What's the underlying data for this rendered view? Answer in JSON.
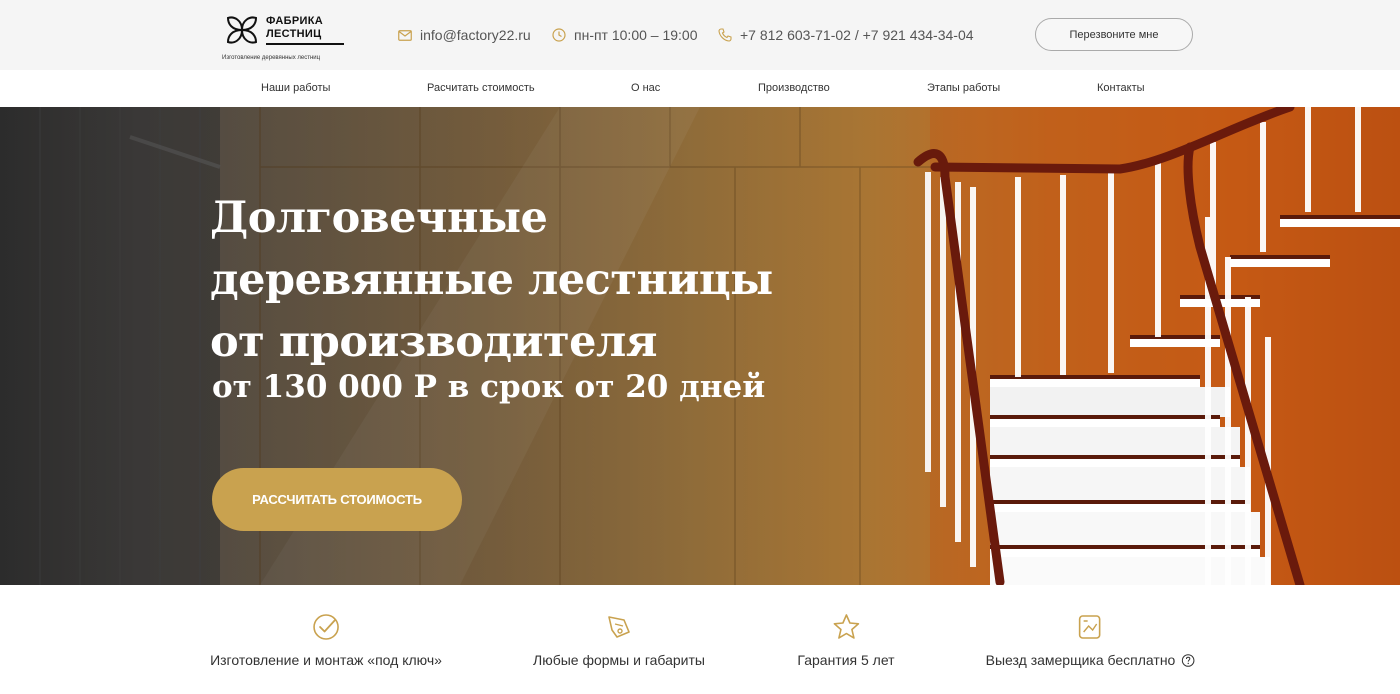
{
  "brand": {
    "name_line1": "ФАБРИКА",
    "name_line2": "ЛЕСТНИЦ",
    "tagline": "Изготовление деревянных лестниц"
  },
  "contacts": {
    "email": "info@factory22.ru",
    "hours": "пн-пт 10:00 – 19:00",
    "phones": "+7 812 603-71-02 / +7 921 434-34-04",
    "callback_label": "Перезвоните мне"
  },
  "nav": {
    "items": [
      {
        "label": "Наши работы"
      },
      {
        "label": "Расчитать стоимость"
      },
      {
        "label": "О нас"
      },
      {
        "label": "Производство"
      },
      {
        "label": "Этапы работы"
      },
      {
        "label": "Контакты"
      }
    ]
  },
  "hero": {
    "title_line1": "Долговечные",
    "title_line2": "деревянные лестницы",
    "title_line3": "от производителя",
    "subtitle": "от 130 000 Р в срок от 20 дней",
    "cta_label": "РАССЧИТАТЬ СТОИМОСТЬ"
  },
  "features": [
    {
      "label": "Изготовление и монтаж «под ключ»",
      "icon": "check-circle-icon"
    },
    {
      "label": "Любые формы и габариты",
      "icon": "pencil-ruler-icon"
    },
    {
      "label": "Гарантия 5 лет",
      "icon": "star-icon"
    },
    {
      "label": "Выезд замерщика бесплатно",
      "icon": "measure-icon"
    }
  ],
  "colors": {
    "accent": "#c9a24f",
    "icon_gold": "#c9a24f"
  }
}
